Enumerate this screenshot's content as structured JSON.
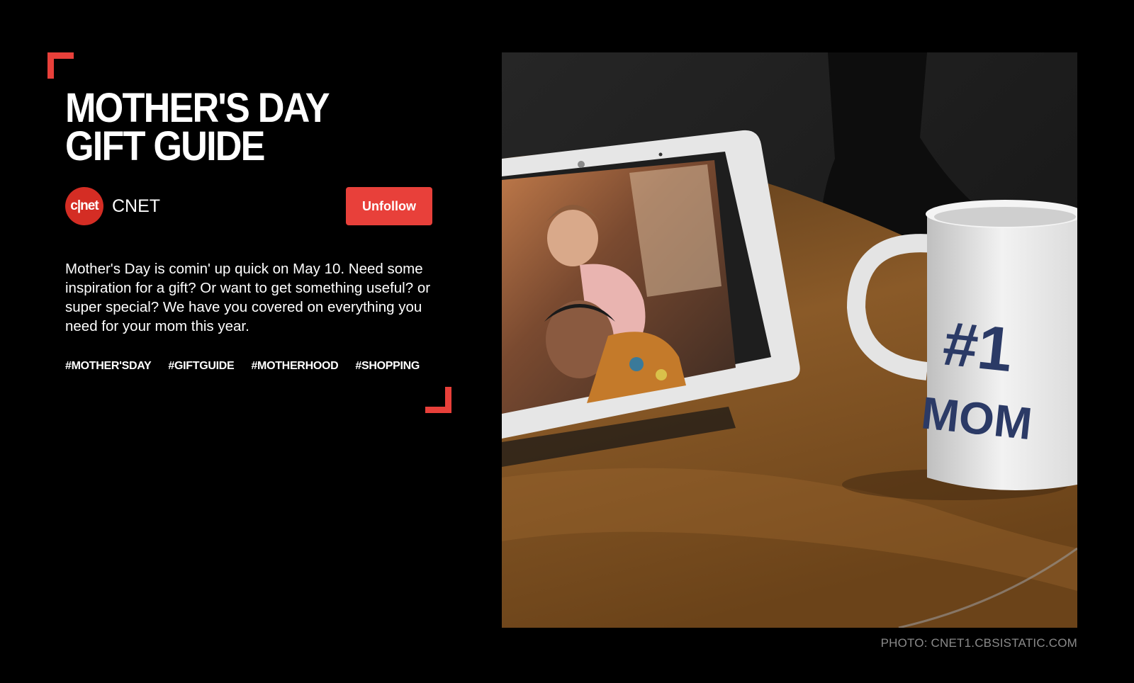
{
  "story": {
    "title": "MOTHER'S DAY GIFT GUIDE",
    "publisher": {
      "logo_text": "c|net",
      "name": "CNET"
    },
    "unfollow_label": "Unfollow",
    "description": "Mother's Day is comin' up quick on May 10. Need some inspiration for a gift? Or want to get something useful? or super special? We have you covered on everything you need for your mom this year.",
    "tags": [
      "#MOTHER'SDAY",
      "#GIFTGUIDE",
      "#MOTHERHOOD",
      "#SHOPPING"
    ]
  },
  "photo": {
    "mug_text_line1": "#1",
    "mug_text_line2": "MOM",
    "credit": "PHOTO: CNET1.CBSISTATIC.COM"
  },
  "colors": {
    "accent": "#e8403a",
    "background": "#000000",
    "logo_red": "#d42d24"
  }
}
